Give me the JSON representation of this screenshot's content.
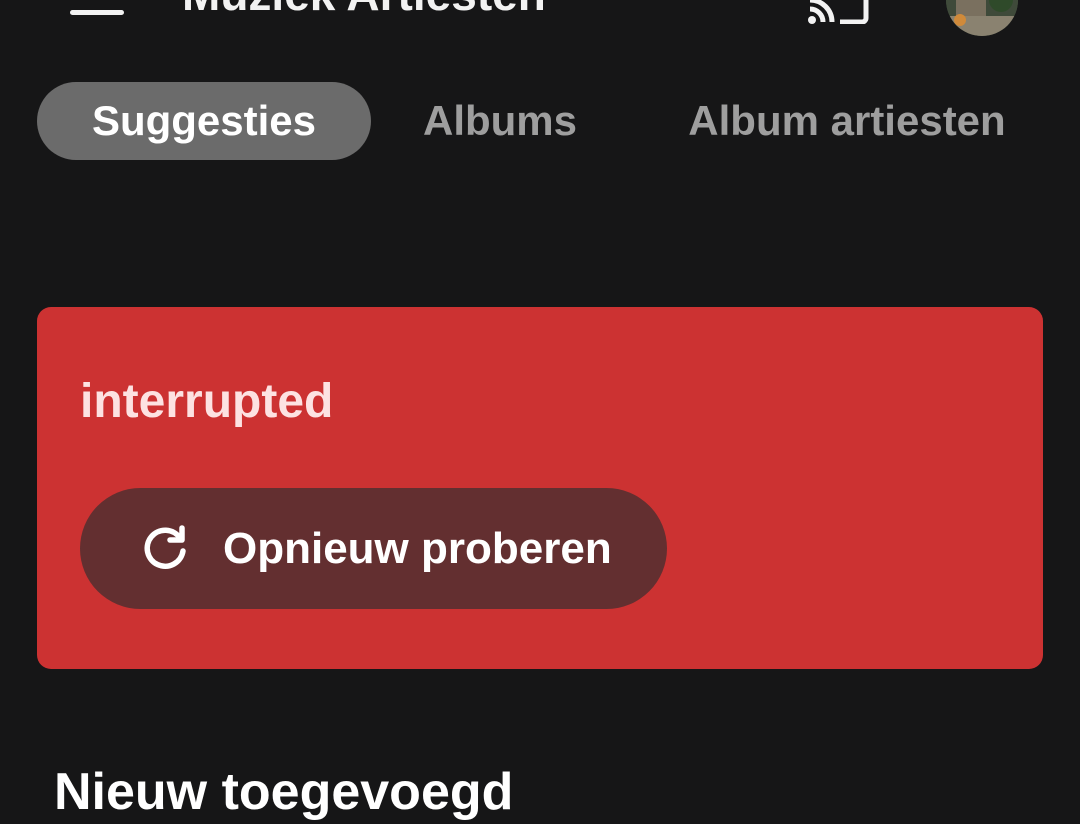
{
  "app_bar": {
    "title": "Muziek Artiesten",
    "menu_icon": "hamburger-menu-icon",
    "cast_icon": "cast-icon",
    "avatar_icon": "user-avatar"
  },
  "tabs": [
    {
      "label": "Suggesties",
      "active": true
    },
    {
      "label": "Albums",
      "active": false
    },
    {
      "label": "Album artiesten",
      "active": false
    }
  ],
  "error_card": {
    "message": "interrupted",
    "retry_label": "Opnieuw proberen",
    "retry_icon": "refresh-icon"
  },
  "section": {
    "heading": "Nieuw toegevoegd"
  },
  "colors": {
    "background": "#161617",
    "active_tab": "#6b6b6b",
    "inactive_tab_text": "#9e9e9e",
    "error_card": "#cc3232",
    "retry_button": "#632f30"
  }
}
